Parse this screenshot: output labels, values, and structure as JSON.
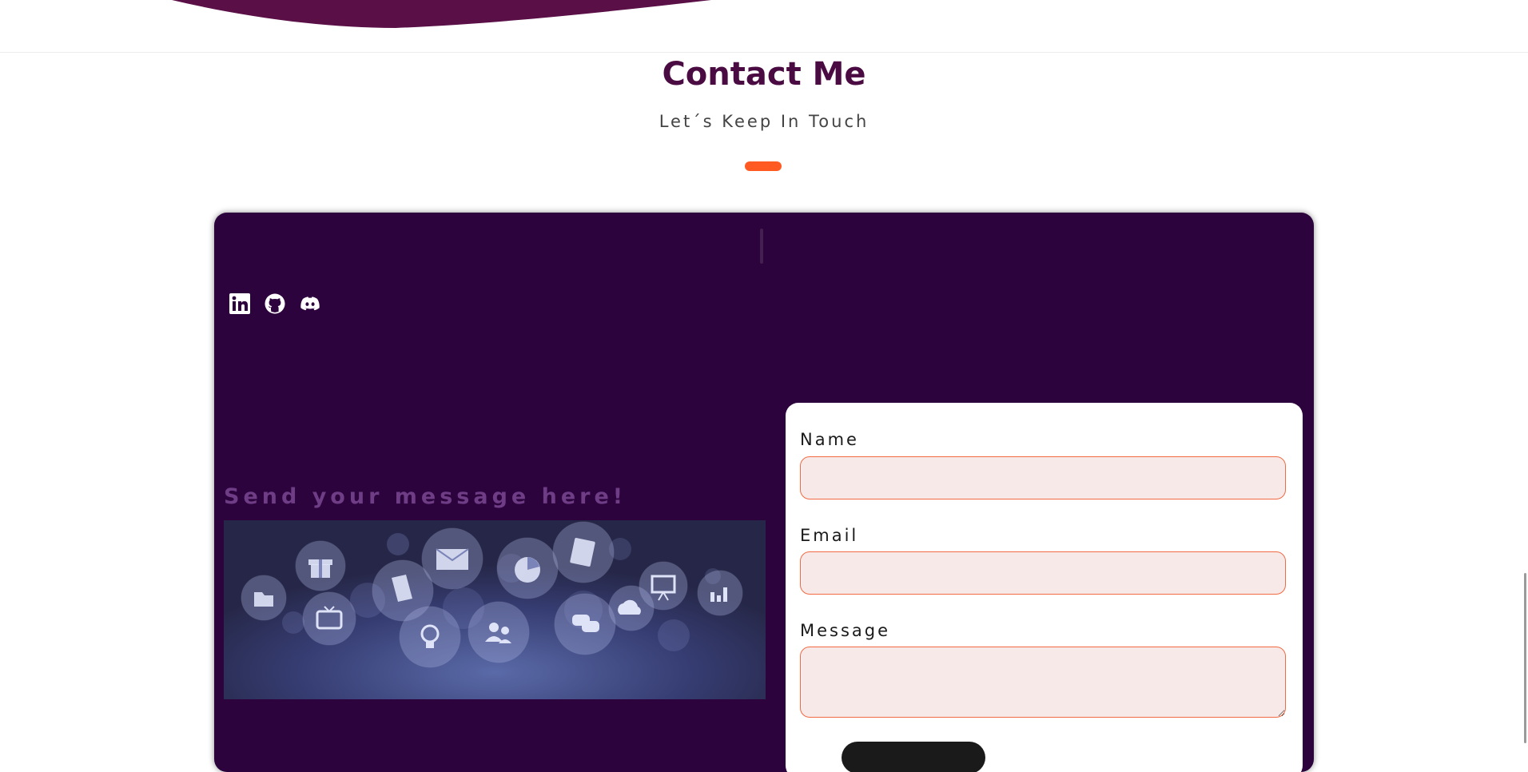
{
  "header": {
    "title": "Contact Me",
    "subtitle": "Let´s Keep In Touch"
  },
  "contact": {
    "send_heading": "Send your message here!",
    "social": [
      {
        "name": "linkedin",
        "icon": "linkedin-icon"
      },
      {
        "name": "github",
        "icon": "github-icon"
      },
      {
        "name": "discord",
        "icon": "discord-icon"
      }
    ],
    "banner_icons": [
      "folder-icon",
      "gift-icon",
      "tv-icon",
      "document-icon",
      "envelope-icon",
      "lightbulb-icon",
      "pie-chart-icon",
      "people-icon",
      "contact-book-icon",
      "chat-icon",
      "cloud-icon",
      "presentation-icon",
      "bar-chart-icon"
    ]
  },
  "form": {
    "name_label": "Name",
    "email_label": "Email",
    "message_label": "Message",
    "name_value": "",
    "email_value": "",
    "message_value": ""
  },
  "colors": {
    "title": "#4a0a42",
    "accent": "#ff5a22",
    "card_bg": "#2c033c",
    "input_bg": "#f6e9e8",
    "input_border": "#f26a43",
    "heading_muted": "#6e3d86"
  }
}
